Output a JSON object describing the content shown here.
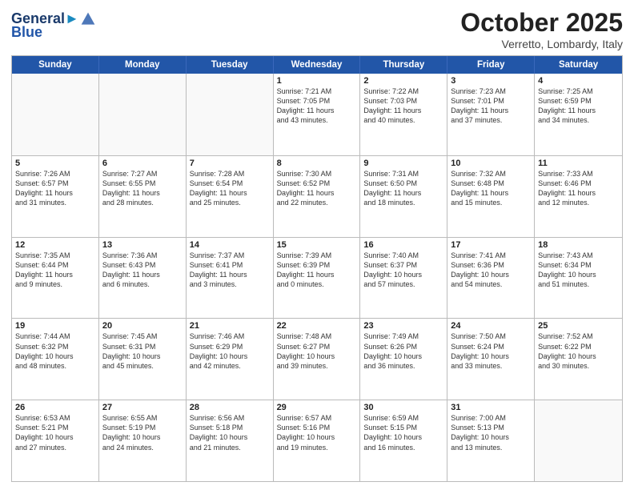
{
  "header": {
    "logo_line1": "General",
    "logo_line2": "Blue",
    "month": "October 2025",
    "location": "Verretto, Lombardy, Italy"
  },
  "weekdays": [
    "Sunday",
    "Monday",
    "Tuesday",
    "Wednesday",
    "Thursday",
    "Friday",
    "Saturday"
  ],
  "weeks": [
    [
      {
        "day": "",
        "empty": true
      },
      {
        "day": "",
        "empty": true
      },
      {
        "day": "",
        "empty": true
      },
      {
        "day": "1",
        "lines": [
          "Sunrise: 7:21 AM",
          "Sunset: 7:05 PM",
          "Daylight: 11 hours",
          "and 43 minutes."
        ]
      },
      {
        "day": "2",
        "lines": [
          "Sunrise: 7:22 AM",
          "Sunset: 7:03 PM",
          "Daylight: 11 hours",
          "and 40 minutes."
        ]
      },
      {
        "day": "3",
        "lines": [
          "Sunrise: 7:23 AM",
          "Sunset: 7:01 PM",
          "Daylight: 11 hours",
          "and 37 minutes."
        ]
      },
      {
        "day": "4",
        "lines": [
          "Sunrise: 7:25 AM",
          "Sunset: 6:59 PM",
          "Daylight: 11 hours",
          "and 34 minutes."
        ]
      }
    ],
    [
      {
        "day": "5",
        "lines": [
          "Sunrise: 7:26 AM",
          "Sunset: 6:57 PM",
          "Daylight: 11 hours",
          "and 31 minutes."
        ]
      },
      {
        "day": "6",
        "lines": [
          "Sunrise: 7:27 AM",
          "Sunset: 6:55 PM",
          "Daylight: 11 hours",
          "and 28 minutes."
        ]
      },
      {
        "day": "7",
        "lines": [
          "Sunrise: 7:28 AM",
          "Sunset: 6:54 PM",
          "Daylight: 11 hours",
          "and 25 minutes."
        ]
      },
      {
        "day": "8",
        "lines": [
          "Sunrise: 7:30 AM",
          "Sunset: 6:52 PM",
          "Daylight: 11 hours",
          "and 22 minutes."
        ]
      },
      {
        "day": "9",
        "lines": [
          "Sunrise: 7:31 AM",
          "Sunset: 6:50 PM",
          "Daylight: 11 hours",
          "and 18 minutes."
        ]
      },
      {
        "day": "10",
        "lines": [
          "Sunrise: 7:32 AM",
          "Sunset: 6:48 PM",
          "Daylight: 11 hours",
          "and 15 minutes."
        ]
      },
      {
        "day": "11",
        "lines": [
          "Sunrise: 7:33 AM",
          "Sunset: 6:46 PM",
          "Daylight: 11 hours",
          "and 12 minutes."
        ]
      }
    ],
    [
      {
        "day": "12",
        "lines": [
          "Sunrise: 7:35 AM",
          "Sunset: 6:44 PM",
          "Daylight: 11 hours",
          "and 9 minutes."
        ]
      },
      {
        "day": "13",
        "lines": [
          "Sunrise: 7:36 AM",
          "Sunset: 6:43 PM",
          "Daylight: 11 hours",
          "and 6 minutes."
        ]
      },
      {
        "day": "14",
        "lines": [
          "Sunrise: 7:37 AM",
          "Sunset: 6:41 PM",
          "Daylight: 11 hours",
          "and 3 minutes."
        ]
      },
      {
        "day": "15",
        "lines": [
          "Sunrise: 7:39 AM",
          "Sunset: 6:39 PM",
          "Daylight: 11 hours",
          "and 0 minutes."
        ]
      },
      {
        "day": "16",
        "lines": [
          "Sunrise: 7:40 AM",
          "Sunset: 6:37 PM",
          "Daylight: 10 hours",
          "and 57 minutes."
        ]
      },
      {
        "day": "17",
        "lines": [
          "Sunrise: 7:41 AM",
          "Sunset: 6:36 PM",
          "Daylight: 10 hours",
          "and 54 minutes."
        ]
      },
      {
        "day": "18",
        "lines": [
          "Sunrise: 7:43 AM",
          "Sunset: 6:34 PM",
          "Daylight: 10 hours",
          "and 51 minutes."
        ]
      }
    ],
    [
      {
        "day": "19",
        "lines": [
          "Sunrise: 7:44 AM",
          "Sunset: 6:32 PM",
          "Daylight: 10 hours",
          "and 48 minutes."
        ]
      },
      {
        "day": "20",
        "lines": [
          "Sunrise: 7:45 AM",
          "Sunset: 6:31 PM",
          "Daylight: 10 hours",
          "and 45 minutes."
        ]
      },
      {
        "day": "21",
        "lines": [
          "Sunrise: 7:46 AM",
          "Sunset: 6:29 PM",
          "Daylight: 10 hours",
          "and 42 minutes."
        ]
      },
      {
        "day": "22",
        "lines": [
          "Sunrise: 7:48 AM",
          "Sunset: 6:27 PM",
          "Daylight: 10 hours",
          "and 39 minutes."
        ]
      },
      {
        "day": "23",
        "lines": [
          "Sunrise: 7:49 AM",
          "Sunset: 6:26 PM",
          "Daylight: 10 hours",
          "and 36 minutes."
        ]
      },
      {
        "day": "24",
        "lines": [
          "Sunrise: 7:50 AM",
          "Sunset: 6:24 PM",
          "Daylight: 10 hours",
          "and 33 minutes."
        ]
      },
      {
        "day": "25",
        "lines": [
          "Sunrise: 7:52 AM",
          "Sunset: 6:22 PM",
          "Daylight: 10 hours",
          "and 30 minutes."
        ]
      }
    ],
    [
      {
        "day": "26",
        "lines": [
          "Sunrise: 6:53 AM",
          "Sunset: 5:21 PM",
          "Daylight: 10 hours",
          "and 27 minutes."
        ]
      },
      {
        "day": "27",
        "lines": [
          "Sunrise: 6:55 AM",
          "Sunset: 5:19 PM",
          "Daylight: 10 hours",
          "and 24 minutes."
        ]
      },
      {
        "day": "28",
        "lines": [
          "Sunrise: 6:56 AM",
          "Sunset: 5:18 PM",
          "Daylight: 10 hours",
          "and 21 minutes."
        ]
      },
      {
        "day": "29",
        "lines": [
          "Sunrise: 6:57 AM",
          "Sunset: 5:16 PM",
          "Daylight: 10 hours",
          "and 19 minutes."
        ]
      },
      {
        "day": "30",
        "lines": [
          "Sunrise: 6:59 AM",
          "Sunset: 5:15 PM",
          "Daylight: 10 hours",
          "and 16 minutes."
        ]
      },
      {
        "day": "31",
        "lines": [
          "Sunrise: 7:00 AM",
          "Sunset: 5:13 PM",
          "Daylight: 10 hours",
          "and 13 minutes."
        ]
      },
      {
        "day": "",
        "empty": true
      }
    ]
  ]
}
